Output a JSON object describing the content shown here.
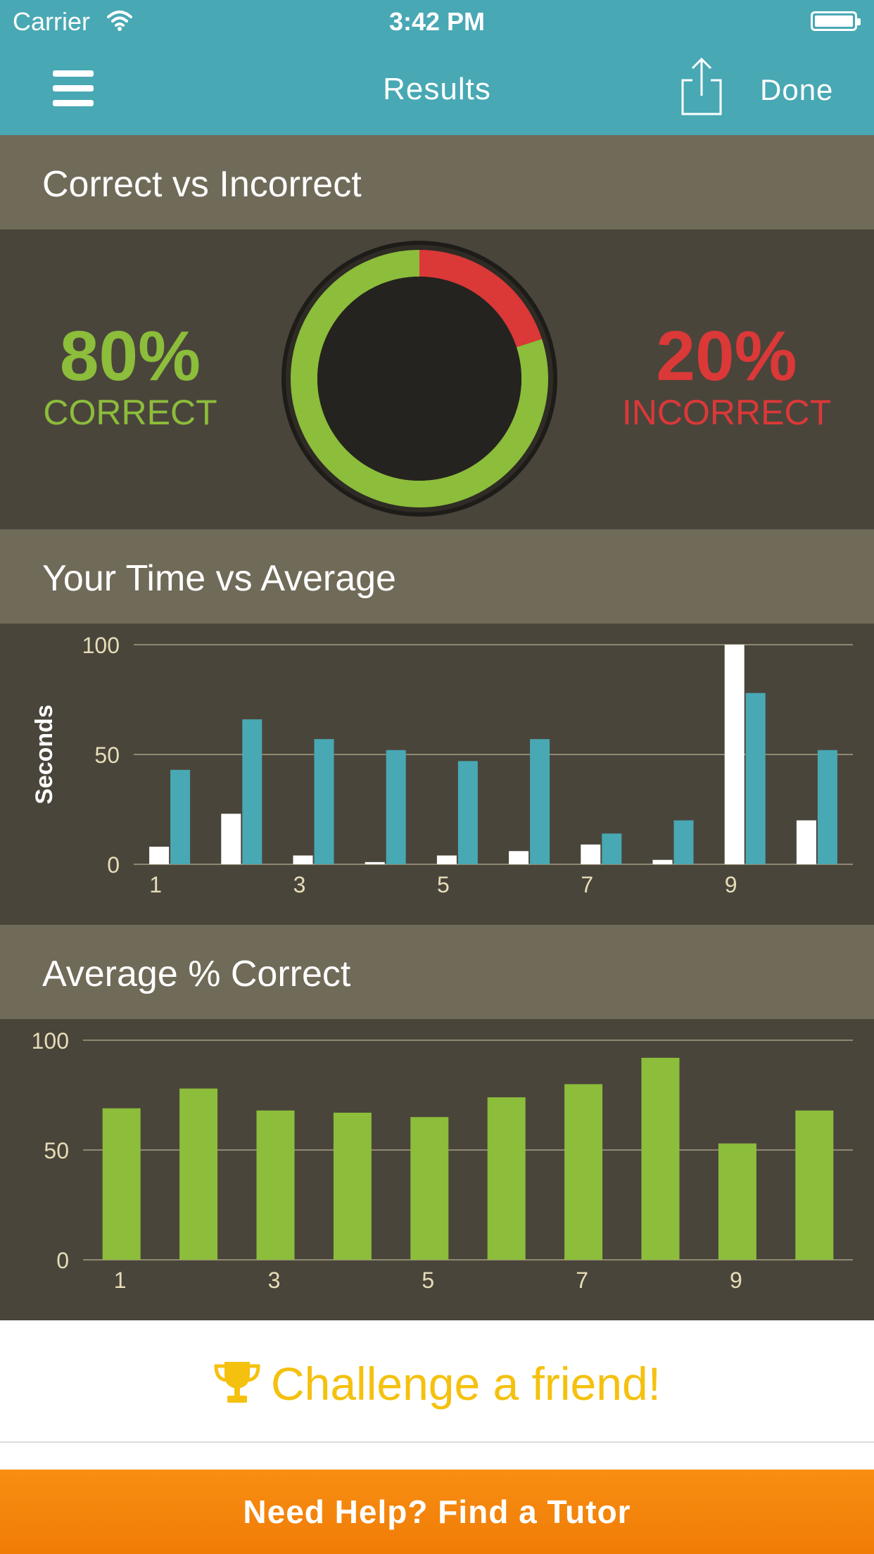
{
  "status_bar": {
    "carrier": "Carrier",
    "time": "3:42 PM"
  },
  "nav": {
    "title": "Results",
    "done_label": "Done"
  },
  "correct_vs_incorrect": {
    "title": "Correct vs Incorrect",
    "correct_pct": "80%",
    "correct_label": "CORRECT",
    "incorrect_pct": "20%",
    "incorrect_label": "INCORRECT",
    "correct_fraction": 0.8,
    "incorrect_fraction": 0.2
  },
  "time_section": {
    "title": "Your Time vs Average"
  },
  "accuracy_section": {
    "title": "Average % Correct"
  },
  "colors": {
    "nav": "#48a8b4",
    "header": "#706a58",
    "panel": "#4a453b",
    "green": "#8cbd3b",
    "red": "#db3838",
    "teal": "#48a8b4",
    "white": "#ffffff",
    "gold": "#f5c10f",
    "orange": "#f6870f",
    "axis_text": "#e6ddb8"
  },
  "icons": [
    "menu-icon",
    "share-icon",
    "wifi-icon",
    "battery-icon",
    "trophy-icon"
  ],
  "chart_data": [
    {
      "type": "bar",
      "title": "",
      "xlabel": "",
      "ylabel": "Seconds",
      "ylim": [
        0,
        100
      ],
      "yticks": [
        0,
        50,
        100
      ],
      "categories": [
        "1",
        "2",
        "3",
        "4",
        "5",
        "6",
        "7",
        "8",
        "9",
        "10"
      ],
      "x_tick_labels": [
        "1",
        "",
        "3",
        "",
        "5",
        "",
        "7",
        "",
        "9",
        ""
      ],
      "series": [
        {
          "values": [
            8,
            23,
            4,
            1,
            4,
            6,
            9,
            2,
            100,
            20
          ]
        },
        {
          "values": [
            43,
            66,
            57,
            52,
            47,
            57,
            14,
            20,
            78,
            52
          ]
        }
      ],
      "grid": true,
      "legend": "none"
    },
    {
      "type": "bar",
      "title": "",
      "xlabel": "",
      "ylabel": "",
      "ylim": [
        0,
        100
      ],
      "yticks": [
        0,
        50,
        100
      ],
      "categories": [
        "1",
        "2",
        "3",
        "4",
        "5",
        "6",
        "7",
        "8",
        "9",
        "10"
      ],
      "x_tick_labels": [
        "1",
        "",
        "3",
        "",
        "5",
        "",
        "7",
        "",
        "9",
        ""
      ],
      "values": [
        69,
        78,
        68,
        67,
        65,
        74,
        80,
        92,
        53,
        68
      ],
      "grid": true,
      "legend": "none"
    }
  ],
  "challenge": {
    "label": "Challenge a friend!"
  },
  "tutor": {
    "label": "Need Help?  Find a Tutor"
  }
}
